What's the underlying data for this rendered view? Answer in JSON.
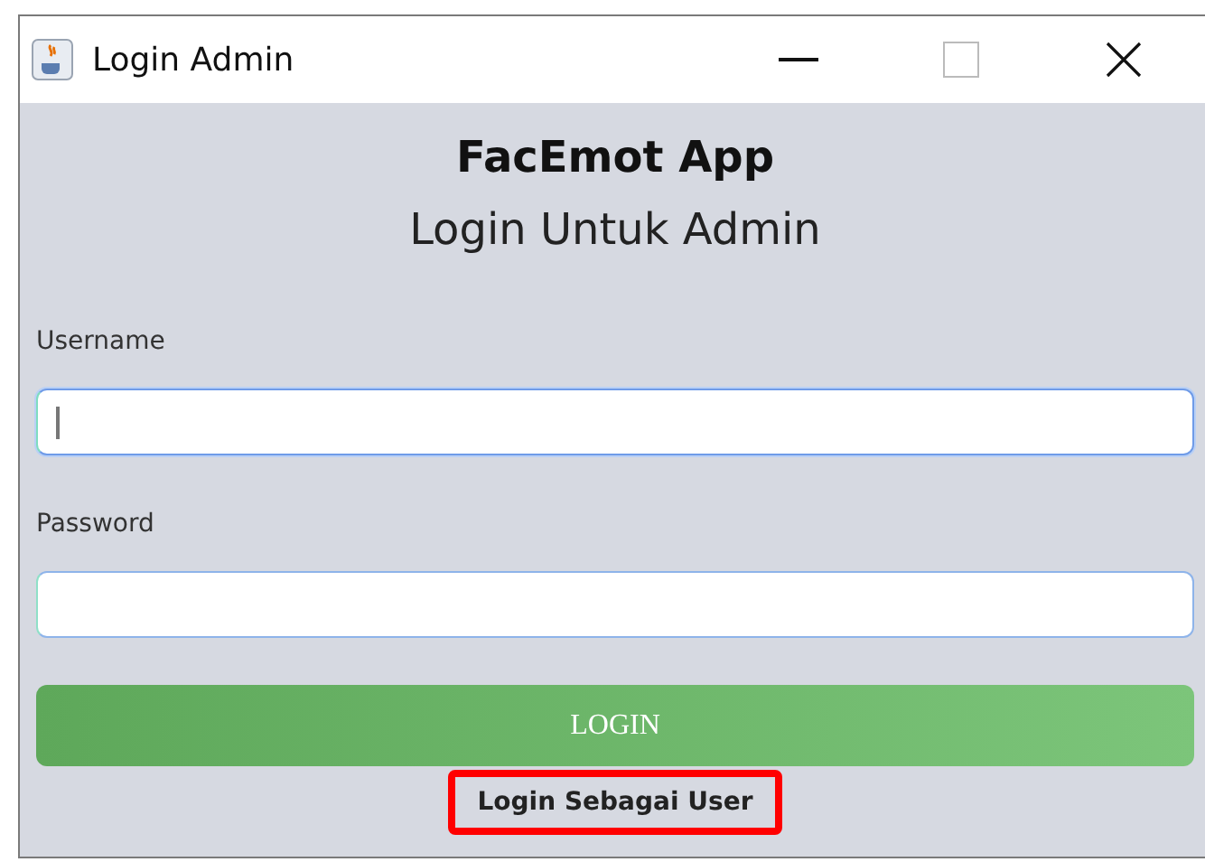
{
  "window": {
    "title": "Login Admin"
  },
  "heading": "FacEmot App",
  "subheading": "Login Untuk Admin",
  "fields": [
    {
      "label": "Username",
      "focused": true
    },
    {
      "label": "Password",
      "focused": false
    }
  ],
  "login_button": "LOGIN",
  "user_link": {
    "label": "Login Sebagai User",
    "highlighted": true
  }
}
